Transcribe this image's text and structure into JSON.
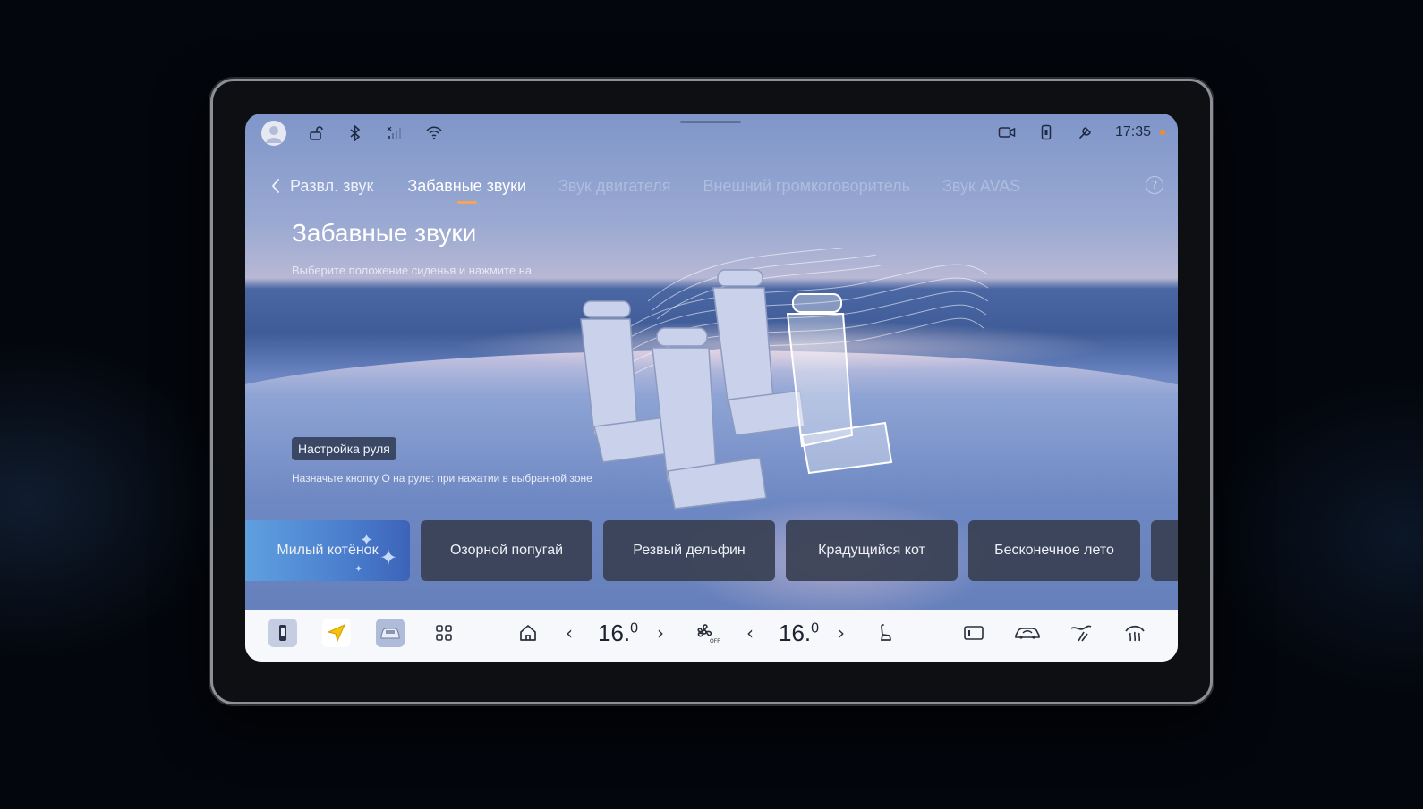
{
  "status_bar": {
    "time": "17:35"
  },
  "nav": {
    "back_label": "Развл. звук",
    "tabs": [
      {
        "label": "Забавные звуки",
        "active": true
      },
      {
        "label": "Звук двигателя",
        "active": false
      },
      {
        "label": "Внешний громкоговоритель",
        "active": false
      },
      {
        "label": "Звук AVAS",
        "active": false
      }
    ],
    "help_label": "?"
  },
  "main": {
    "title": "Забавные звуки",
    "subtitle": "Выберите положение сиденья и нажмите на",
    "steering_chip": "Настройка руля",
    "hint": "Назначьте кнопку О на руле: при нажатии в выбранной зоне"
  },
  "sounds": [
    {
      "label": "Милый котёнок",
      "selected": true
    },
    {
      "label": "Озорной попугай",
      "selected": false
    },
    {
      "label": "Резвый дельфин",
      "selected": false
    },
    {
      "label": "Крадущийся кот",
      "selected": false
    },
    {
      "label": "Бесконечное лето",
      "selected": false
    }
  ],
  "dock": {
    "temp_left": "16.",
    "temp_left_decimal": "0",
    "temp_right": "16.",
    "temp_right_decimal": "0"
  },
  "colors": {
    "accent": "#f3a45c",
    "selected_card": "#4b7fce",
    "card": "#383f52",
    "dock": "#f7f8fb",
    "notification_dot": "#ff8a1c"
  }
}
